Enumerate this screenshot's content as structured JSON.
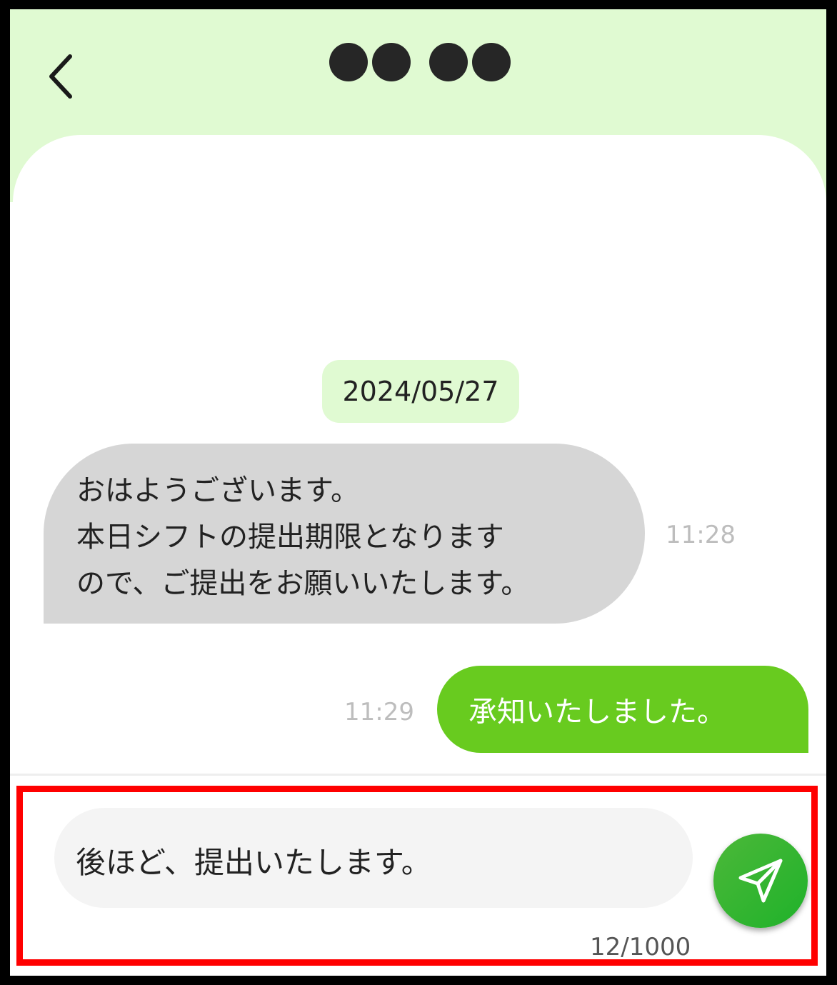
{
  "header": {
    "back_icon": "chevron-left-icon",
    "title_masked": "●●●●"
  },
  "chat": {
    "date": "2024/05/27",
    "messages": [
      {
        "direction": "incoming",
        "text": "おはようございます。\n本日シフトの提出期限となります\nので、ご提出をお願いいたします。",
        "time": "11:28"
      },
      {
        "direction": "outgoing",
        "text": "承知いたしました。",
        "time": "11:29"
      }
    ]
  },
  "composer": {
    "value": "後ほど、提出いたします。",
    "char_count": "12/1000",
    "send_icon": "send-icon"
  },
  "colors": {
    "header_bg": "#e0fad2",
    "incoming_bubble": "#d6d6d6",
    "outgoing_bubble": "#68cb1f",
    "send_button": "#2cb52c",
    "highlight_border": "#ff0000"
  }
}
